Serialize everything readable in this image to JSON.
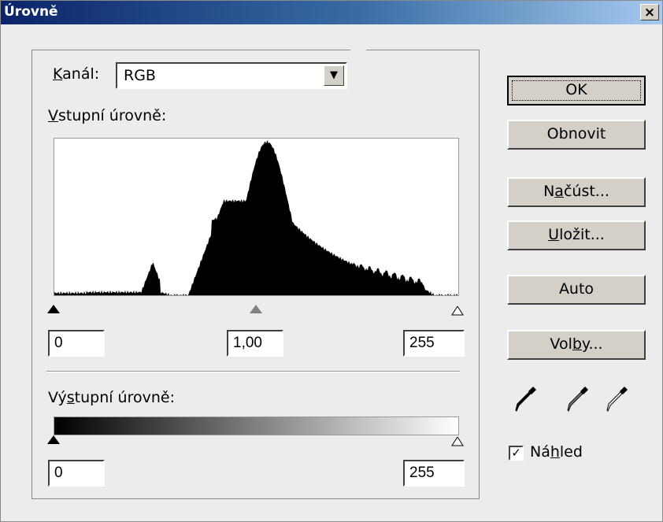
{
  "window": {
    "title": "Úrovně",
    "close_label": "×"
  },
  "channel": {
    "label_accel": "K",
    "label_rest": "anál:",
    "value": "RGB"
  },
  "input_levels": {
    "label_accel": "V",
    "label_rest": "stupní úrovně:",
    "black": "0",
    "gamma": "1,00",
    "white": "255"
  },
  "output_levels": {
    "label_pre": "Vý",
    "label_accel": "s",
    "label_rest": "tupní úrovně:",
    "black": "0",
    "white": "255"
  },
  "buttons": {
    "ok": "OK",
    "reset": "Obnovit",
    "load_pre": "N",
    "load_accel": "a",
    "load_rest": "čúst...",
    "save_accel": "U",
    "save_rest": "ložit...",
    "auto": "Auto",
    "options_pre": "Vol",
    "options_accel": "b",
    "options_rest": "y..."
  },
  "eyedroppers": [
    "black-point-eyedropper-icon",
    "gray-point-eyedropper-icon",
    "white-point-eyedropper-icon"
  ],
  "preview": {
    "checked": true,
    "label_pre": "Ná",
    "label_accel": "h",
    "label_rest": "led"
  },
  "colors": {
    "title_start": "#0a246a",
    "title_end": "#a6caf0",
    "dialog_bg": "#ececec",
    "button_face": "#d4d0c8"
  }
}
